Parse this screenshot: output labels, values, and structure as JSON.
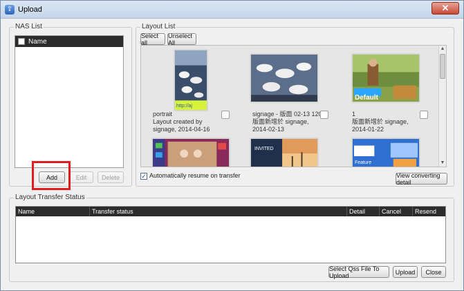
{
  "window": {
    "title": "Upload",
    "close_symbol": "✕"
  },
  "nas": {
    "group_label": "NAS List",
    "header_name": "Name",
    "add_label": "Add",
    "edit_label": "Edit",
    "delete_label": "Delete"
  },
  "layout": {
    "group_label": "Layout List",
    "select_all_label": "Select all",
    "unselect_all_label": "Unselect All",
    "items": [
      {
        "lines": [
          "portrait",
          "Layout created by",
          "signage, 2014-04-16"
        ],
        "checked": false
      },
      {
        "lines": [
          "signage - 版面 02-13 1200",
          "版面新增於 signage,",
          "2014-02-13"
        ],
        "checked": false
      },
      {
        "lines": [
          "1",
          "版面新增於 signage,",
          "2014-01-22"
        ],
        "checked": false
      }
    ],
    "thumb_labels": [
      "http://aj",
      "Default",
      "INVITED",
      "Feature"
    ],
    "auto_resume_label": "Automatically resume on transfer",
    "auto_resume_checked": true,
    "view_converting_label": "View converting detail"
  },
  "transfer": {
    "group_label": "Layout Transfer Status",
    "columns": [
      "Name",
      "Transfer status",
      "Detail",
      "Cancel",
      "Resend"
    ]
  },
  "footer": {
    "select_qss_label": "Select Qss File To Upload",
    "upload_label": "Upload",
    "close_label": "Close"
  },
  "colors": {
    "highlight_box": "#e21b1b",
    "header_bar": "#2b2b2b"
  }
}
